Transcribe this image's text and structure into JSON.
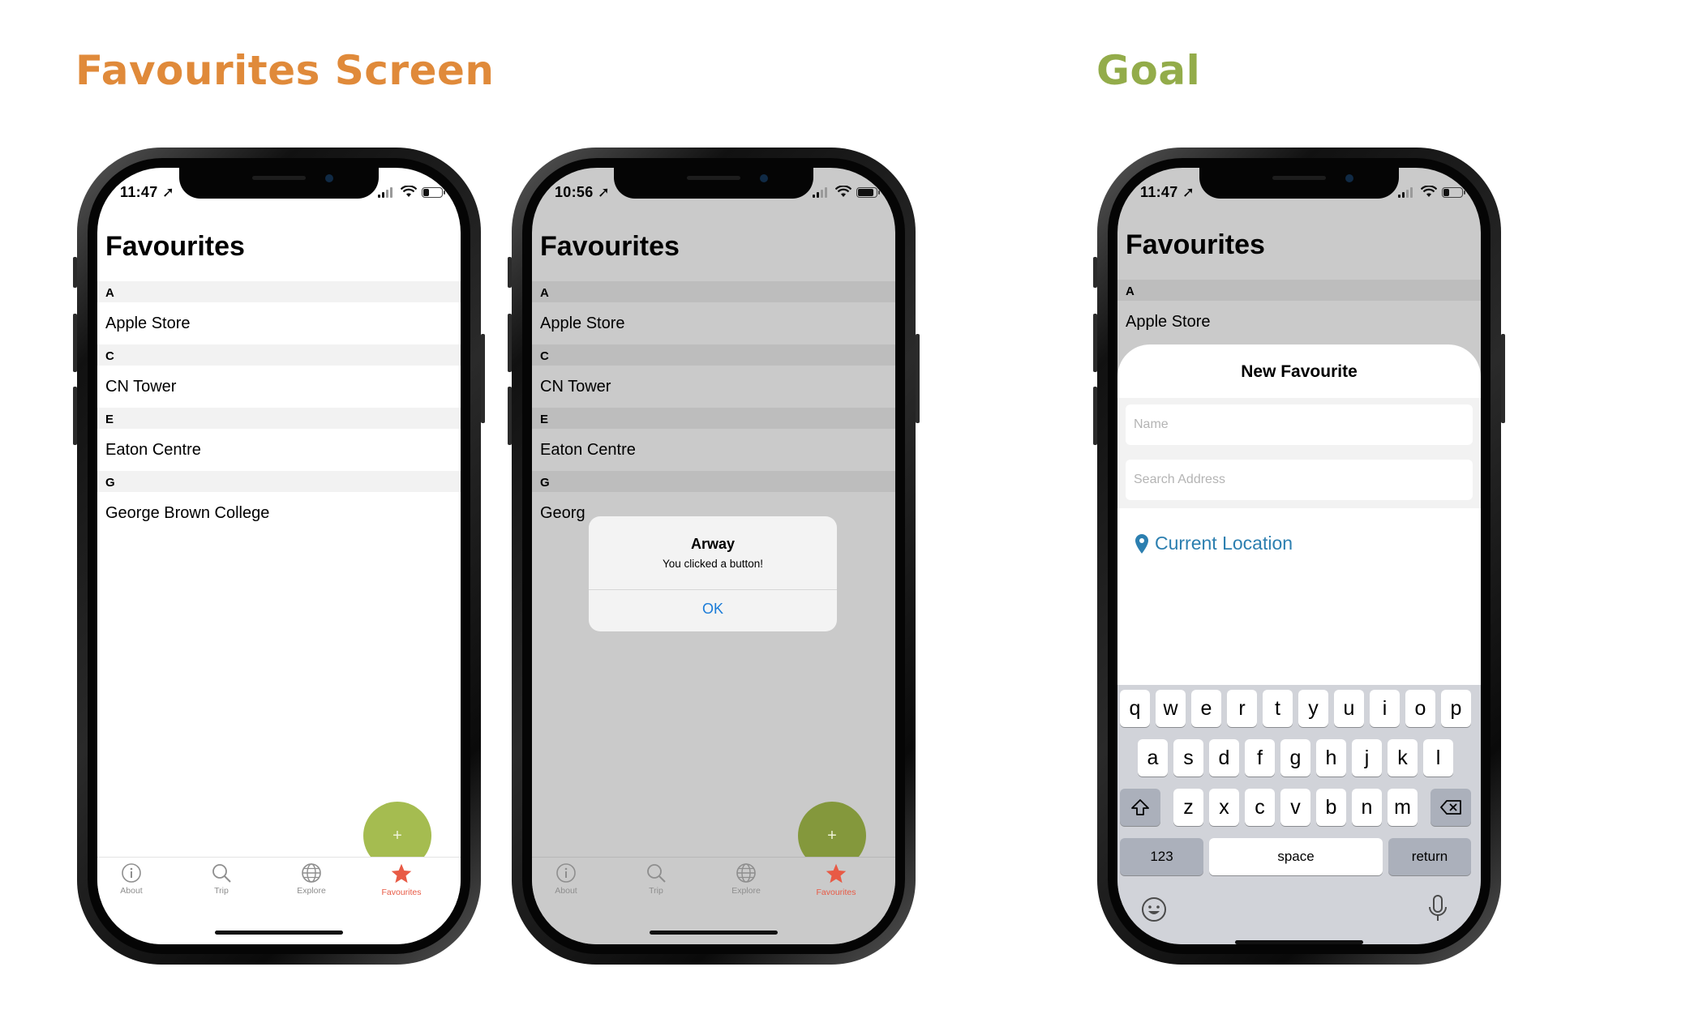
{
  "headings": {
    "left": "Favourites Screen",
    "right": "Goal"
  },
  "favourites": {
    "title": "Favourites",
    "sections": [
      {
        "letter": "A",
        "item": "Apple Store"
      },
      {
        "letter": "C",
        "item": "CN Tower"
      },
      {
        "letter": "E",
        "item": "Eaton Centre"
      },
      {
        "letter": "G",
        "item": "George Brown College"
      }
    ],
    "fab_label": "+"
  },
  "phones": [
    {
      "time": "11:47"
    },
    {
      "time": "10:56"
    },
    {
      "time": "11:47"
    }
  ],
  "phone2": {
    "truncated_item": "Georg"
  },
  "tabs": [
    {
      "label": "About",
      "icon": "info-icon"
    },
    {
      "label": "Trip",
      "icon": "search-icon"
    },
    {
      "label": "Explore",
      "icon": "globe-icon"
    },
    {
      "label": "Favourites",
      "icon": "star-icon"
    }
  ],
  "alert": {
    "title": "Arway",
    "message": "You clicked a button!",
    "ok": "OK"
  },
  "goal": {
    "title": "Favourites",
    "section": "A",
    "item": "Apple Store",
    "sheet_title": "New Favourite",
    "name_placeholder": "Name",
    "address_placeholder": "Search Address",
    "current_location": "Current Location"
  },
  "keyboard": {
    "row1": [
      "q",
      "w",
      "e",
      "r",
      "t",
      "y",
      "u",
      "i",
      "o",
      "p"
    ],
    "row2": [
      "a",
      "s",
      "d",
      "f",
      "g",
      "h",
      "j",
      "k",
      "l"
    ],
    "row3": [
      "z",
      "x",
      "c",
      "v",
      "b",
      "n",
      "m"
    ],
    "numbers": "123",
    "space": "space",
    "return": "return"
  },
  "colors": {
    "accent_orange": "#e08a3a",
    "accent_green": "#93ac4a",
    "fab": "#a5bc50",
    "active_tab": "#e85a45",
    "link_blue": "#2c7fb0"
  }
}
